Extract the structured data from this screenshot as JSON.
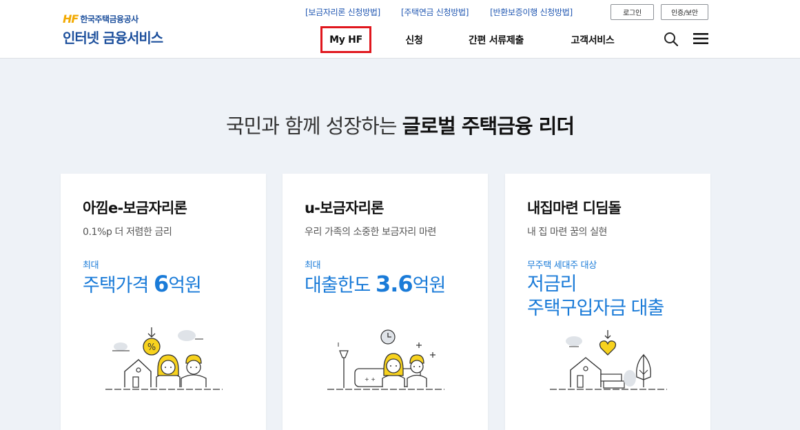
{
  "header": {
    "logo": {
      "mark": "HF",
      "org_name": "한국주택금융공사",
      "service_name": "인터넷 금융서비스"
    },
    "quick_links": [
      "[보금자리론 신청방법]",
      "[주택연금 신청방법]",
      "[반환보증이행 신청방법]"
    ],
    "login_label": "로그인",
    "cert_label": "인증/보안",
    "nav": {
      "my_hf": "My HF",
      "apply": "신청",
      "docs": "간편 서류제출",
      "customer_service": "고객서비스"
    },
    "icons": [
      "search-icon",
      "hamburger-menu-icon"
    ],
    "highlight_color": "#e0161d"
  },
  "hero": {
    "title_light": "국민과 함께 성장하는",
    "title_bold": "글로벌 주택금융 리더"
  },
  "cards": [
    {
      "title": "아낌e-보금자리론",
      "subtitle": "0.1%p 더 저렴한 금리",
      "label": "최대",
      "value_prefix": "주택가격 ",
      "value_number": "6",
      "value_suffix": "억원"
    },
    {
      "title": "u-보금자리론",
      "subtitle": "우리 가족의 소중한 보금자리 마련",
      "label": "최대",
      "value_prefix": "대출한도 ",
      "value_number": "3.6",
      "value_suffix": "억원"
    },
    {
      "title": "내집마련 디딤돌",
      "subtitle": "내 집 마련 꿈의 실현",
      "label": "무주택 세대주 대상",
      "value_line1": "저금리",
      "value_line2": "주택구입자금 대출"
    }
  ],
  "colors": {
    "brand_blue": "#1c4f9c",
    "accent_blue": "#1a7bd8",
    "illustration_yellow": "#f7d21e",
    "background": "#eef2f7"
  }
}
